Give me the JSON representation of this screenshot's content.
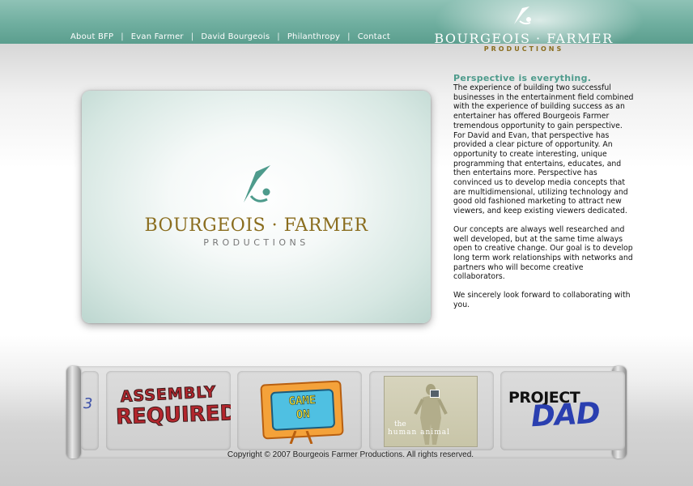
{
  "nav": {
    "items": [
      "About BFP",
      "Evan Farmer",
      "David Bourgeois",
      "Philanthropy",
      "Contact"
    ]
  },
  "brand": {
    "name": "BOURGEOIS · FARMER",
    "sub": "PRODUCTIONS"
  },
  "hero": {
    "name": "BOURGEOIS · FARMER",
    "sub": "PRODUCTIONS"
  },
  "content": {
    "heading": "Perspective is everything.",
    "p1": "The experience of building two successful businesses in the entertainment field combined with the experience of building success as an entertainer has offered Bourgeois Farmer tremendous opportunity to gain perspective. For David and Evan, that perspective has provided a clear picture of opportunity. An opportunity to create interesting, unique programming that entertains, educates, and then entertains more. Perspective has convinced us to develop media concepts that are multidimensional, utilizing technology and good old fashioned marketing to attract new viewers, and keep existing viewers dedicated.",
    "p2": "Our concepts are always well researched and well developed, but at the same time always open to creative change. Our goal is to develop long term work relationships with networks and partners who will become creative collaborators.",
    "p3": "We sincerely look forward to collaborating with you."
  },
  "gallery": {
    "partial_glyph": "3",
    "assembly": {
      "line1": "ASSEMBLY",
      "line2": "REQUIRED"
    },
    "gameon": {
      "line1": "GAME",
      "line2": "ON"
    },
    "human": {
      "the": "the",
      "title": "human animal"
    },
    "projdad": {
      "line1": "PROJECT",
      "line2": "DAD"
    }
  },
  "footer": {
    "copyright": "Copyright © 2007 Bourgeois Farmer Productions. All rights reserved."
  },
  "colors": {
    "teal": "#6fae9f",
    "accent_text": "#4e9b8c",
    "gold": "#8a6d1e"
  },
  "icons": {
    "brand_mark": "swoosh-figure-icon",
    "scroll_left": "scroll-left-icon",
    "scroll_right": "scroll-right-icon"
  }
}
